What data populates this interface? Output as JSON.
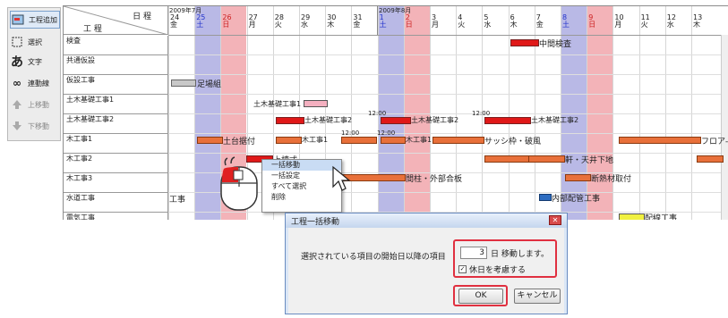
{
  "toolbar": {
    "items": [
      {
        "label": "工程追加",
        "icon": "add-process-icon"
      },
      {
        "label": "選択",
        "icon": "select-icon"
      },
      {
        "label": "文字",
        "icon": "text-icon"
      },
      {
        "label": "連動線",
        "icon": "link-line-icon"
      },
      {
        "label": "上移動",
        "icon": "move-up-icon"
      },
      {
        "label": "下移動",
        "icon": "move-down-icon"
      }
    ]
  },
  "header": {
    "date_label": "日 程",
    "process_label": "工 程",
    "month1": "2009年7月",
    "month2": "2009年8月",
    "days": [
      {
        "d": "24",
        "w": "金",
        "type": "weekday"
      },
      {
        "d": "25",
        "w": "土",
        "type": "sat"
      },
      {
        "d": "26",
        "w": "日",
        "type": "sun"
      },
      {
        "d": "27",
        "w": "月",
        "type": "weekday"
      },
      {
        "d": "28",
        "w": "火",
        "type": "weekday"
      },
      {
        "d": "29",
        "w": "水",
        "type": "weekday"
      },
      {
        "d": "30",
        "w": "木",
        "type": "weekday"
      },
      {
        "d": "31",
        "w": "金",
        "type": "weekday"
      },
      {
        "d": "1",
        "w": "土",
        "type": "sat"
      },
      {
        "d": "2",
        "w": "日",
        "type": "sun"
      },
      {
        "d": "3",
        "w": "月",
        "type": "weekday"
      },
      {
        "d": "4",
        "w": "火",
        "type": "weekday"
      },
      {
        "d": "5",
        "w": "水",
        "type": "weekday"
      },
      {
        "d": "6",
        "w": "木",
        "type": "weekday"
      },
      {
        "d": "7",
        "w": "金",
        "type": "weekday"
      },
      {
        "d": "8",
        "w": "土",
        "type": "sat"
      },
      {
        "d": "9",
        "w": "日",
        "type": "sun"
      },
      {
        "d": "10",
        "w": "月",
        "type": "weekday"
      },
      {
        "d": "11",
        "w": "火",
        "type": "weekday"
      },
      {
        "d": "12",
        "w": "水",
        "type": "weekday"
      },
      {
        "d": "13",
        "w": "木",
        "type": "weekday"
      }
    ]
  },
  "rows": [
    {
      "label": "検査"
    },
    {
      "label": "共通仮設"
    },
    {
      "label": "仮設工事"
    },
    {
      "label": "土木基礎工事1"
    },
    {
      "label": "土木基礎工事2"
    },
    {
      "label": "木工事1"
    },
    {
      "label": "木工事2"
    },
    {
      "label": "木工事3"
    },
    {
      "label": "水道工事"
    },
    {
      "label": "電気工事"
    }
  ],
  "bars": [
    {
      "label": "中間検査",
      "color": "red"
    },
    {
      "label": "足場組",
      "color": "gray"
    },
    {
      "label": "土木基礎工事1",
      "color": "pink"
    },
    {
      "label": "土木基礎工事2",
      "color": "red"
    },
    {
      "label": "土木基礎工事2",
      "color": "red"
    },
    {
      "label": "土木基礎工事2",
      "color": "red"
    },
    {
      "label": "土台据付",
      "color": "orange"
    },
    {
      "label": "木工事1",
      "color": "orange"
    },
    {
      "label": "木工事1",
      "color": "orange"
    },
    {
      "label": "サッシ枠・破風",
      "color": "orange"
    },
    {
      "label": "フロア-",
      "color": "orange"
    },
    {
      "label": "上棟式",
      "color": "red"
    },
    {
      "label": "",
      "color": "orange"
    },
    {
      "label": "軒・天井下地",
      "color": "orange"
    },
    {
      "label": "",
      "color": "orange"
    },
    {
      "label": "間柱・外部合板",
      "color": "orange"
    },
    {
      "label": "断熱材取付",
      "color": "orange"
    },
    {
      "label": "内部配管工事",
      "color": "blue"
    },
    {
      "label": "工事",
      "color": "none"
    },
    {
      "label": "配線工事",
      "color": "yellow"
    }
  ],
  "times": [
    "12:00",
    "12:00",
    "12:00",
    "12:00"
  ],
  "context_menu": {
    "items": [
      "一括移動",
      "一括設定",
      "すべて選択",
      "削除"
    ]
  },
  "dialog": {
    "title": "工程一括移動",
    "message": "選択されている項目の開始日以降の項目",
    "value": "3",
    "unit": "日 移動します。",
    "checkbox_label": "休日を考慮する",
    "checkbox_mark": "✓",
    "ok_label": "OK",
    "cancel_label": "キャンセル",
    "close_label": "✕"
  }
}
